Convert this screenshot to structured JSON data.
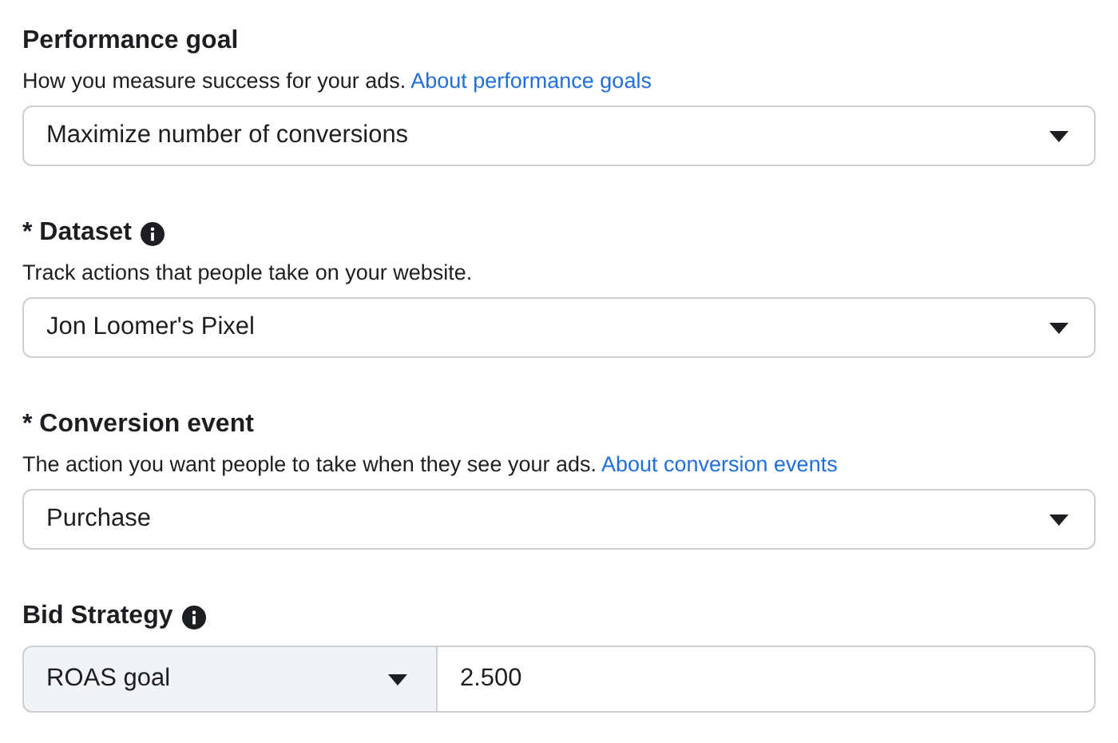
{
  "sections": [
    {
      "kind": "select",
      "title": "Performance goal",
      "info": false,
      "description": "How you measure success for your ads.",
      "link": "About performance goals",
      "value": "Maximize number of conversions"
    },
    {
      "kind": "select",
      "title": "* Dataset",
      "info": true,
      "description": "Track actions that people take on your website.",
      "value": "Jon Loomer's Pixel"
    },
    {
      "kind": "select",
      "title": "* Conversion event",
      "info": false,
      "description": "The action you want people to take when they see your ads.",
      "link": "About conversion events",
      "value": "Purchase"
    },
    {
      "kind": "select_with_input",
      "title": "Bid Strategy",
      "info": true,
      "value": "ROAS goal",
      "input_value": "2.500"
    }
  ]
}
